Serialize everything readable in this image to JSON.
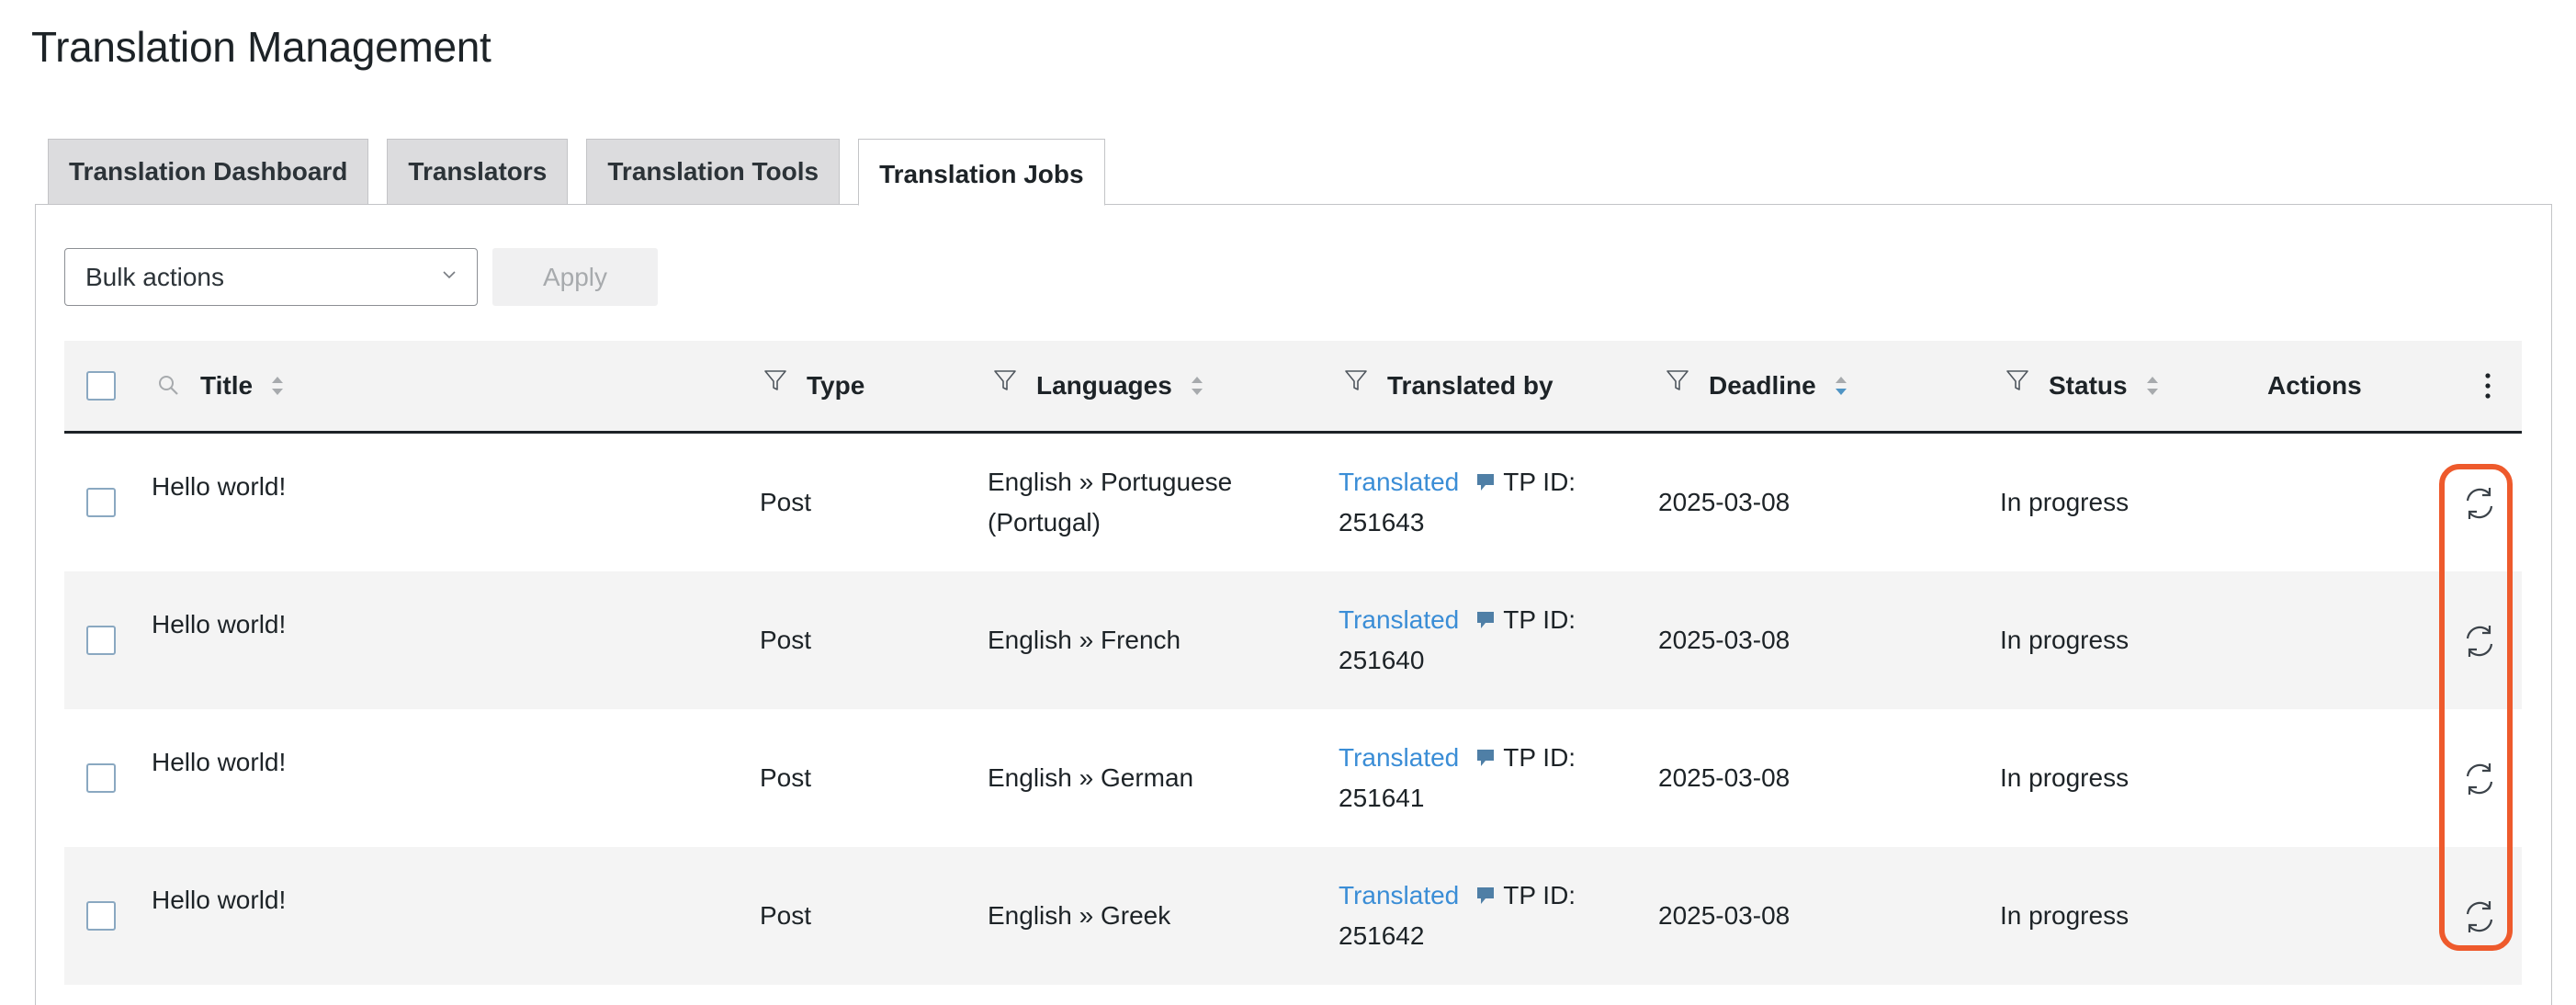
{
  "page": {
    "title": "Translation Management"
  },
  "tabs": [
    {
      "label": "Translation Dashboard",
      "active": false
    },
    {
      "label": "Translators",
      "active": false
    },
    {
      "label": "Translation Tools",
      "active": false
    },
    {
      "label": "Translation Jobs",
      "active": true
    }
  ],
  "toolbar": {
    "bulk_actions": "Bulk actions",
    "apply": "Apply"
  },
  "columns": {
    "title": "Title",
    "type": "Type",
    "languages": "Languages",
    "translated_by": "Translated by",
    "deadline": "Deadline",
    "status": "Status",
    "actions": "Actions"
  },
  "rows": [
    {
      "title": "Hello world!",
      "type": "Post",
      "languages_line1": "English » Portuguese",
      "languages_line2": "(Portugal)",
      "translated": "Translated",
      "tp_label": "TP ID:",
      "tp_id": "251643",
      "deadline": "2025-03-08",
      "status": "In progress"
    },
    {
      "title": "Hello world!",
      "type": "Post",
      "languages_line1": "English » French",
      "languages_line2": "",
      "translated": "Translated",
      "tp_label": "TP ID:",
      "tp_id": "251640",
      "deadline": "2025-03-08",
      "status": "In progress"
    },
    {
      "title": "Hello world!",
      "type": "Post",
      "languages_line1": "English » German",
      "languages_line2": "",
      "translated": "Translated",
      "tp_label": "TP ID:",
      "tp_id": "251641",
      "deadline": "2025-03-08",
      "status": "In progress"
    },
    {
      "title": "Hello world!",
      "type": "Post",
      "languages_line1": "English » Greek",
      "languages_line2": "",
      "translated": "Translated",
      "tp_label": "TP ID:",
      "tp_id": "251642",
      "deadline": "2025-03-08",
      "status": "In progress"
    }
  ],
  "icons": {
    "search": "search-icon",
    "filter": "filter-icon",
    "sort": "sort-icon",
    "more": "more-vertical-icon",
    "comment": "comment-icon",
    "refresh": "refresh-icon"
  },
  "colors": {
    "link": "#3a8dd6",
    "annotation": "#ee5a2c",
    "comment_icon": "#4f7fa6",
    "sort_active": "#4f94c4"
  }
}
